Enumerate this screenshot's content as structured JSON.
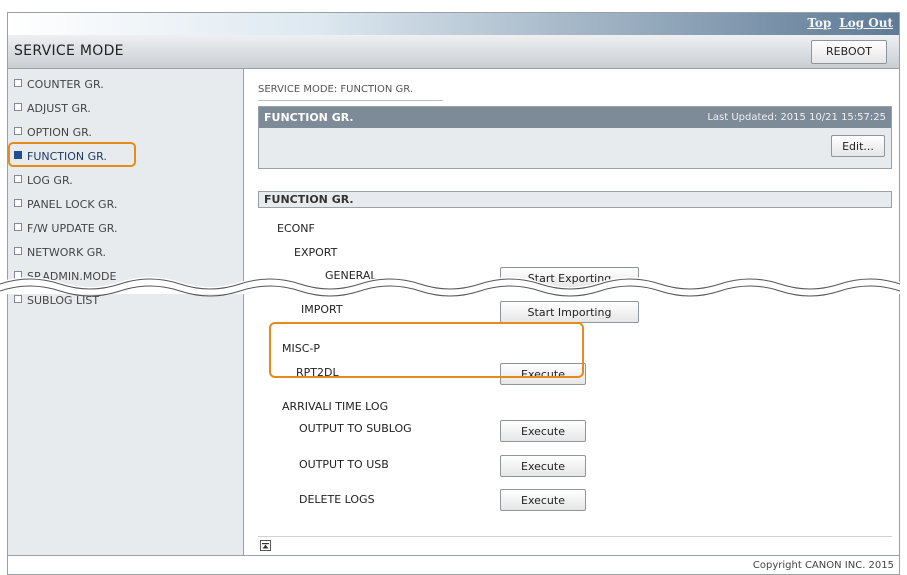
{
  "top_links": {
    "top": "Top",
    "logout": "Log Out"
  },
  "header": {
    "title": "SERVICE MODE",
    "reboot_label": "REBOOT"
  },
  "sidebar": {
    "items": [
      {
        "label": "COUNTER GR."
      },
      {
        "label": "ADJUST GR."
      },
      {
        "label": "OPTION GR."
      },
      {
        "label": "FUNCTION GR.",
        "active": true
      },
      {
        "label": "LOG GR."
      },
      {
        "label": "PANEL LOCK GR."
      },
      {
        "label": "F/W UPDATE GR."
      },
      {
        "label": "NETWORK GR."
      },
      {
        "label": "SP.ADMIN.MODE"
      },
      {
        "label": "SUBLOG LIST"
      }
    ]
  },
  "main": {
    "breadcrumb": "SERVICE MODE: FUNCTION GR.",
    "panel": {
      "title": "FUNCTION GR.",
      "last_updated": "Last Updated: 2015 10/21 15:57:25",
      "edit_label": "Edit..."
    },
    "section_title": "FUNCTION GR.",
    "econf": {
      "label": "ECONF",
      "export": "EXPORT",
      "general": "GENERAL",
      "start_exporting": "Start Exporting",
      "import": "IMPORT",
      "start_importing": "Start Importing"
    },
    "misc": {
      "label": "MISC-P",
      "rpt2dl": "RPT2DL",
      "execute": "Execute"
    },
    "arrival": {
      "label": "ARRIVALI TIME LOG",
      "rows": [
        {
          "label": "OUTPUT TO SUBLOG",
          "button": "Execute"
        },
        {
          "label": "OUTPUT TO USB",
          "button": "Execute"
        },
        {
          "label": "DELETE LOGS",
          "button": "Execute"
        }
      ]
    }
  },
  "footer": {
    "copyright": "Copyright CANON INC. 2015"
  },
  "colors": {
    "highlight": "#e58b1c",
    "panel_header": "#7d8a97",
    "active_nav": "#1f4f8e"
  }
}
